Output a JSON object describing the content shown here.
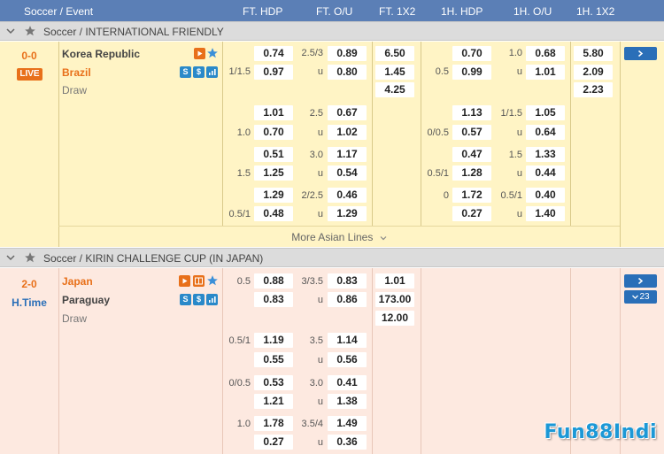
{
  "header": {
    "event": "Soccer / Event",
    "ft_hdp": "FT. HDP",
    "ft_ou": "FT. O/U",
    "ft_1x2": "FT. 1X2",
    "h1_hdp": "1H. HDP",
    "h1_ou": "1H. O/U",
    "h1_1x2": "1H. 1X2"
  },
  "colors": {
    "header": "#5b7fb6",
    "match1_bg": "#fff4c5",
    "match2_bg": "#fde9e0",
    "accent_orange": "#e8701a",
    "accent_blue": "#2a6fb8"
  },
  "league1": {
    "name": "Soccer / INTERNATIONAL FRIENDLY",
    "score": "0-0",
    "status": "LIVE",
    "home": "Korea Republic",
    "away": "Brazil",
    "draw": "Draw",
    "ft1x2": [
      "6.50",
      "1.45",
      "4.25"
    ],
    "h1x2": [
      "5.80",
      "2.09",
      "2.23"
    ],
    "lines": [
      {
        "fthdp": [
          "",
          "1/1.5"
        ],
        "fthdp_odds": [
          "0.74",
          "0.97"
        ],
        "ftou": [
          "2.5/3",
          "u"
        ],
        "ftou_odds": [
          "0.89",
          "0.80"
        ],
        "h1hdp": [
          "",
          "0.5"
        ],
        "h1hdp_odds": [
          "0.70",
          "0.99"
        ],
        "h1ou": [
          "1.0",
          "u"
        ],
        "h1ou_odds": [
          "0.68",
          "1.01"
        ]
      },
      {
        "fthdp": [
          "",
          "1.0"
        ],
        "fthdp_odds": [
          "1.01",
          "0.70"
        ],
        "ftou": [
          "2.5",
          "u"
        ],
        "ftou_odds": [
          "0.67",
          "1.02"
        ],
        "h1hdp": [
          "",
          "0/0.5"
        ],
        "h1hdp_odds": [
          "1.13",
          "0.57"
        ],
        "h1ou": [
          "1/1.5",
          "u"
        ],
        "h1ou_odds": [
          "1.05",
          "0.64"
        ]
      },
      {
        "fthdp": [
          "",
          "1.5"
        ],
        "fthdp_odds": [
          "0.51",
          "1.25"
        ],
        "ftou": [
          "3.0",
          "u"
        ],
        "ftou_odds": [
          "1.17",
          "0.54"
        ],
        "h1hdp": [
          "",
          "0.5/1"
        ],
        "h1hdp_odds": [
          "0.47",
          "1.28"
        ],
        "h1ou": [
          "1.5",
          "u"
        ],
        "h1ou_odds": [
          "1.33",
          "0.44"
        ]
      },
      {
        "fthdp": [
          "",
          "0.5/1"
        ],
        "fthdp_odds": [
          "1.29",
          "0.48"
        ],
        "ftou": [
          "2/2.5",
          "u"
        ],
        "ftou_odds": [
          "0.46",
          "1.29"
        ],
        "h1hdp": [
          "0",
          ""
        ],
        "h1hdp_odds": [
          "1.72",
          "0.27"
        ],
        "h1ou": [
          "0.5/1",
          "u"
        ],
        "h1ou_odds": [
          "0.40",
          "1.40"
        ]
      }
    ],
    "more": "More Asian Lines"
  },
  "league2": {
    "name": "Soccer / KIRIN CHALLENGE CUP (IN JAPAN)",
    "score": "2-0",
    "status": "H.Time",
    "home": "Japan",
    "away": "Paraguay",
    "draw": "Draw",
    "ft1x2": [
      "1.01",
      "173.00",
      "12.00"
    ],
    "more_count": "23",
    "lines": [
      {
        "fthdp": [
          "0.5",
          ""
        ],
        "fthdp_odds": [
          "0.88",
          "0.83"
        ],
        "ftou": [
          "3/3.5",
          "u"
        ],
        "ftou_odds": [
          "0.83",
          "0.86"
        ]
      },
      {
        "fthdp": [
          "0.5/1",
          ""
        ],
        "fthdp_odds": [
          "1.19",
          "0.55"
        ],
        "ftou": [
          "3.5",
          "u"
        ],
        "ftou_odds": [
          "1.14",
          "0.56"
        ]
      },
      {
        "fthdp": [
          "0/0.5",
          ""
        ],
        "fthdp_odds": [
          "0.53",
          "1.21"
        ],
        "ftou": [
          "3.0",
          "u"
        ],
        "ftou_odds": [
          "0.41",
          "1.38"
        ]
      },
      {
        "fthdp": [
          "1.0",
          ""
        ],
        "fthdp_odds": [
          "1.78",
          "0.27"
        ],
        "ftou": [
          "3.5/4",
          "u"
        ],
        "ftou_odds": [
          "1.49",
          "0.36"
        ]
      }
    ]
  },
  "watermark": "Fun88Indi"
}
